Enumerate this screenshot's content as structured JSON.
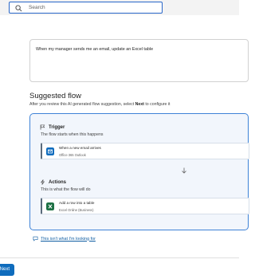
{
  "search": {
    "placeholder": "Search"
  },
  "prompt": {
    "text": "When my manager sends me an email, update an Excel table"
  },
  "suggested": {
    "title": "Suggested flow",
    "desc_prefix": "After you review this AI generated flow suggestion, select ",
    "desc_bold": "Next",
    "desc_suffix": " to configure it"
  },
  "trigger": {
    "title": "Trigger",
    "subtitle": "The flow starts when this happens",
    "step": {
      "title": "When a new email arrives",
      "connector": "Office 365 Outlook",
      "color": "#0f6cbd"
    }
  },
  "actions": {
    "title": "Actions",
    "subtitle": "This is what the flow will do",
    "step": {
      "title": "Add a row into a table",
      "connector": "Excel Online (Business)",
      "color": "#1e7145"
    }
  },
  "feedback": {
    "link": "This isn't what I'm looking for"
  },
  "footer": {
    "next_label": "Next"
  },
  "colors": {
    "accent": "#0f6cbd",
    "card_border": "#3e82d6",
    "card_bg": "#f2f6fc"
  }
}
